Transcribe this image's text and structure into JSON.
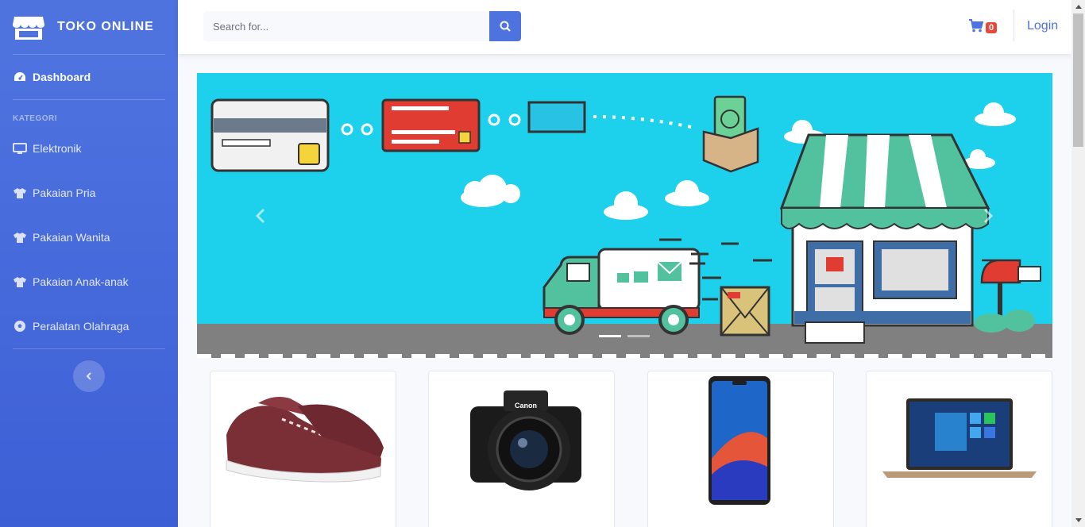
{
  "brand": {
    "name": "TOKO ONLINE"
  },
  "sidebar": {
    "dashboard_label": "Dashboard",
    "heading": "KATEGORI",
    "items": [
      {
        "label": "Elektronik",
        "icon": "desktop-icon"
      },
      {
        "label": "Pakaian Pria",
        "icon": "tshirt-icon"
      },
      {
        "label": "Pakaian Wanita",
        "icon": "tshirt-icon"
      },
      {
        "label": "Pakaian Anak-anak",
        "icon": "tshirt-icon"
      },
      {
        "label": "Peralatan Olahraga",
        "icon": "football-icon"
      }
    ]
  },
  "search": {
    "placeholder": "Search for..."
  },
  "topbar": {
    "cart_count": "0",
    "login_label": "Login"
  },
  "carousel": {
    "slides": 2,
    "active_slide": 1
  },
  "products": [
    {
      "name": "Sneakers",
      "icon": "shoe-icon"
    },
    {
      "name": "Canon camera",
      "icon": "camera-icon"
    },
    {
      "name": "Smartphone",
      "icon": "phone-icon"
    },
    {
      "name": "Laptop",
      "icon": "laptop-icon"
    }
  ],
  "colors": {
    "primary": "#4e73df",
    "danger": "#e74a3b",
    "banner": "#1dd1ec"
  }
}
